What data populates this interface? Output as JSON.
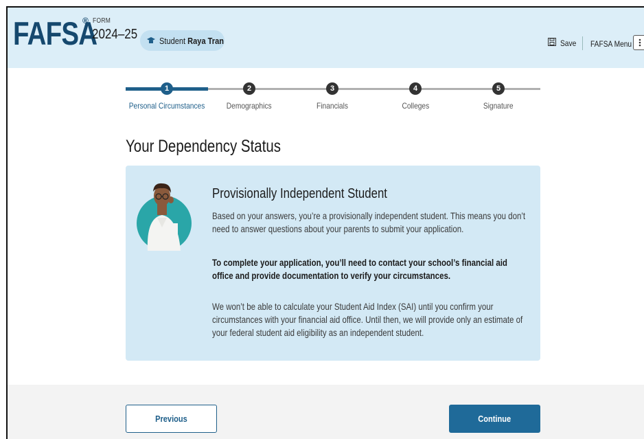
{
  "header": {
    "logo": "FAFSA",
    "registered_mark": "®",
    "form_label": "FORM",
    "form_year": "2024–25",
    "student_prefix": "Student",
    "student_name": "Raya Tran",
    "save_label": "Save",
    "menu_label": "FAFSA Menu"
  },
  "steps": [
    {
      "number": "1",
      "label": "Personal Circumstances",
      "state": "active"
    },
    {
      "number": "2",
      "label": "Demographics",
      "state": "upcoming"
    },
    {
      "number": "3",
      "label": "Financials",
      "state": "upcoming"
    },
    {
      "number": "4",
      "label": "Colleges",
      "state": "upcoming"
    },
    {
      "number": "5",
      "label": "Signature",
      "state": "upcoming"
    }
  ],
  "page": {
    "title": "Your Dependency Status"
  },
  "card": {
    "heading": "Provisionally Independent Student",
    "p1": "Based on your answers, you’re a provisionally independent student. This means you don’t need to answer questions about your parents to submit your application.",
    "p2": "To complete your application, you’ll need to contact your school’s financial aid office and provide documentation to verify your circumstances.",
    "p3": "We won’t be able to calculate your Student Aid Index (SAI) until you confirm your circumstances with your financial aid office. Until then, we will provide only an estimate of your federal student aid eligibility as an independent student."
  },
  "footer": {
    "previous_label": "Previous",
    "continue_label": "Continue"
  },
  "colors": {
    "brand_navy": "#15486e",
    "header_bg": "#dceef8",
    "card_bg": "#d3e9f5",
    "primary_button": "#1f6a99",
    "active_step": "#1f5f8a"
  },
  "icons": {
    "student": "graduation-cap-icon",
    "save": "save-icon",
    "menu": "kebab-menu-icon"
  }
}
